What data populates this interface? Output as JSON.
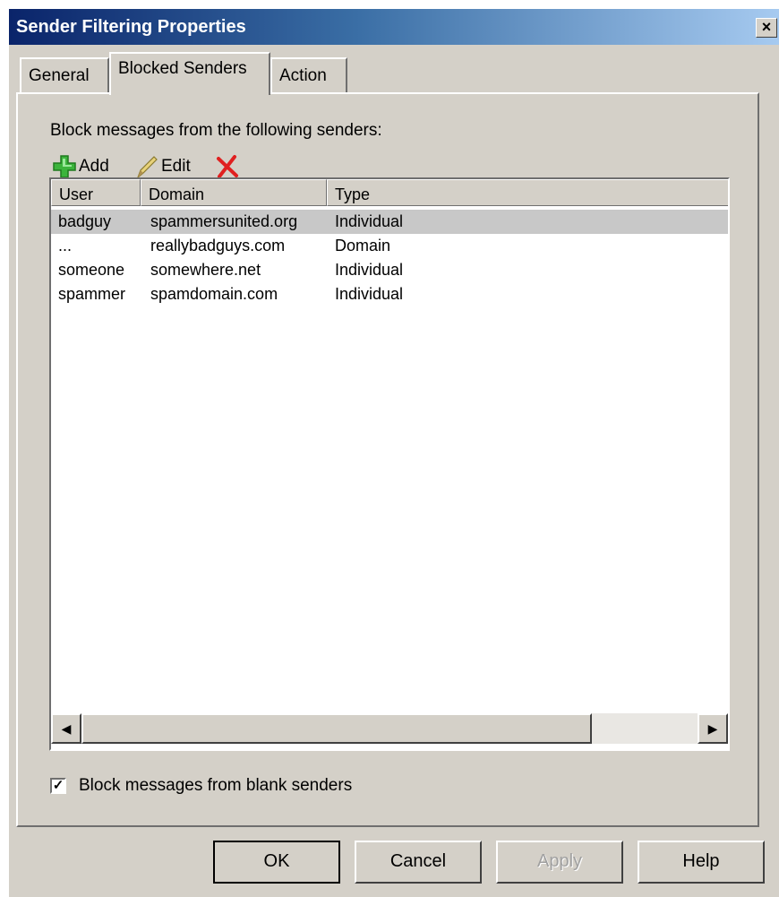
{
  "window": {
    "title": "Sender Filtering Properties",
    "close_label": "×"
  },
  "tabs": [
    {
      "label": "General",
      "active": false
    },
    {
      "label": "Blocked Senders",
      "active": true
    },
    {
      "label": "Action",
      "active": false
    }
  ],
  "panel": {
    "instructions": "Block messages from the following senders:"
  },
  "toolbar": {
    "add_label": "Add",
    "edit_label": "Edit",
    "add_icon": "add-plus-icon",
    "edit_icon": "pencil-icon",
    "delete_icon": "red-x-icon"
  },
  "list": {
    "columns": [
      "User",
      "Domain",
      "Type"
    ],
    "rows": [
      {
        "user": "badguy",
        "domain": "spammersunited.org",
        "type": "Individual",
        "selected": true
      },
      {
        "user": "...",
        "domain": "reallybadguys.com",
        "type": "Domain",
        "selected": false
      },
      {
        "user": "someone",
        "domain": "somewhere.net",
        "type": "Individual",
        "selected": false
      },
      {
        "user": "spammer",
        "domain": "spamdomain.com",
        "type": "Individual",
        "selected": false
      }
    ]
  },
  "blank_senders": {
    "label": "Block messages from blank senders",
    "checked": true
  },
  "buttons": {
    "ok": "OK",
    "cancel": "Cancel",
    "apply": "Apply",
    "help": "Help"
  },
  "colors": {
    "titlebar_start": "#0a246a",
    "titlebar_end": "#a6caf0",
    "dialog_bg": "#d4d0c8",
    "delete_red": "#e02020",
    "add_green": "#3cb43c"
  }
}
